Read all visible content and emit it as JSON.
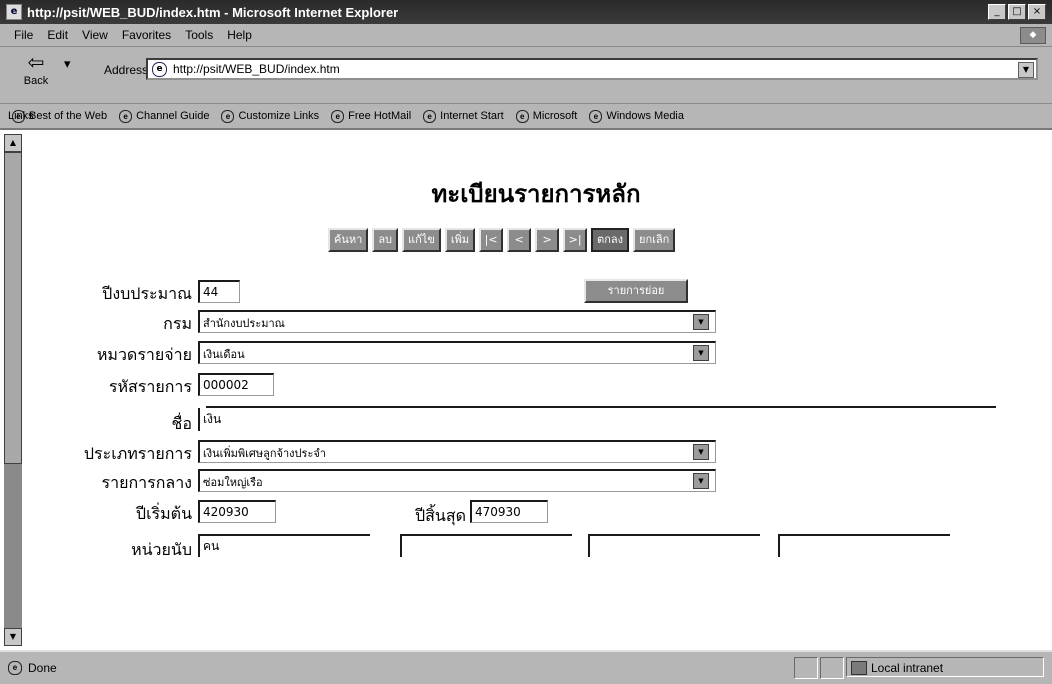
{
  "window": {
    "title": "http://psit/WEB_BUD/index.htm - Microsoft Internet Explorer",
    "controls": [
      "_",
      "□",
      "×"
    ]
  },
  "menu": [
    "File",
    "Edit",
    "View",
    "Favorites",
    "Tools",
    "Help"
  ],
  "nav": {
    "back_label": "Back",
    "address_label": "Address",
    "address_value": "http://psit/WEB_BUD/index.htm"
  },
  "links": {
    "label": "Links",
    "items": [
      "Best of the Web",
      "Channel Guide",
      "Customize Links",
      "Free HotMail",
      "Internet Start",
      "Microsoft",
      "Windows Media"
    ]
  },
  "form": {
    "title": "ทะเบียนรายการหลัก",
    "toolbar": {
      "search": "ค้นหา",
      "delete": "ลบ",
      "edit": "แก้ไข",
      "add": "เพิ่ม",
      "first": "|<",
      "prev": "<",
      "next": ">",
      "last": ">|",
      "save": "ตกลง",
      "cancel": "ยกเลิก"
    },
    "detail_button": "รายการย่อย",
    "fields": {
      "budget_year": {
        "label": "ปีงบประมาณ",
        "value": "44"
      },
      "department": {
        "label": "กรม",
        "value": "สำนักงบประมาณ"
      },
      "expense_category": {
        "label": "หมวดรายจ่าย",
        "value": "เงินเดือน"
      },
      "item_code": {
        "label": "รหัสรายการ",
        "value": "000002"
      },
      "name": {
        "label": "ชื่อ",
        "value": "เงิน"
      },
      "item_type": {
        "label": "ประเภทรายการ",
        "value": "เงินเพิ่มพิเศษลูกจ้างประจำ"
      },
      "central_item": {
        "label": "รายการกลาง",
        "value": "ซ่อมใหญ่เรือ"
      },
      "start_year": {
        "label": "ปีเริ่มต้น",
        "value": "420930"
      },
      "end_year": {
        "label": "ปีสิ้นสุด",
        "value": "470930"
      },
      "unit": {
        "label": "หน่วยนับ",
        "value": "คน"
      }
    }
  },
  "status": {
    "text": "Done",
    "zone": "Local intranet"
  }
}
